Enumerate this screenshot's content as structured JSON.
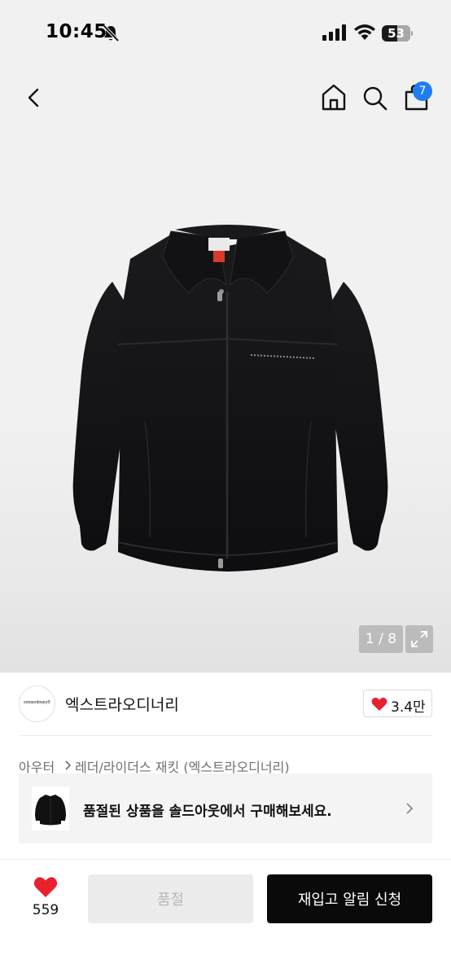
{
  "status_bar": {
    "time": "10:45",
    "battery": "53",
    "icons": [
      "bell-slash-icon",
      "signal-icon",
      "wifi-icon",
      "battery-icon"
    ]
  },
  "nav": {
    "icons": [
      "back-chevron-icon",
      "home-icon",
      "search-icon",
      "shopping-bag-icon"
    ],
    "cart_count": "7"
  },
  "gallery": {
    "counter": "1 / 8",
    "current": 1,
    "total": 8,
    "expand_icon": "expand-arrows-icon"
  },
  "brand": {
    "logo_text": "extraordinary®",
    "name": "엑스트라오디너리",
    "like_count": "3.4만"
  },
  "breadcrumb": {
    "level1": "아우터",
    "level2": "레더/라이더스 재킷 (엑스트라오디너리)"
  },
  "soldout_banner": {
    "text": "품절된 상품을 솔드아웃에서 구매해보세요."
  },
  "bottom_bar": {
    "wish_count": "559",
    "soldout_label": "품절",
    "restock_label": "재입고 알림 신청"
  },
  "colors": {
    "accent_blue": "#1f7cf2",
    "heart_red": "#e8212f",
    "primary_black": "#0a0a0a",
    "disabled_gray": "#ececec"
  }
}
